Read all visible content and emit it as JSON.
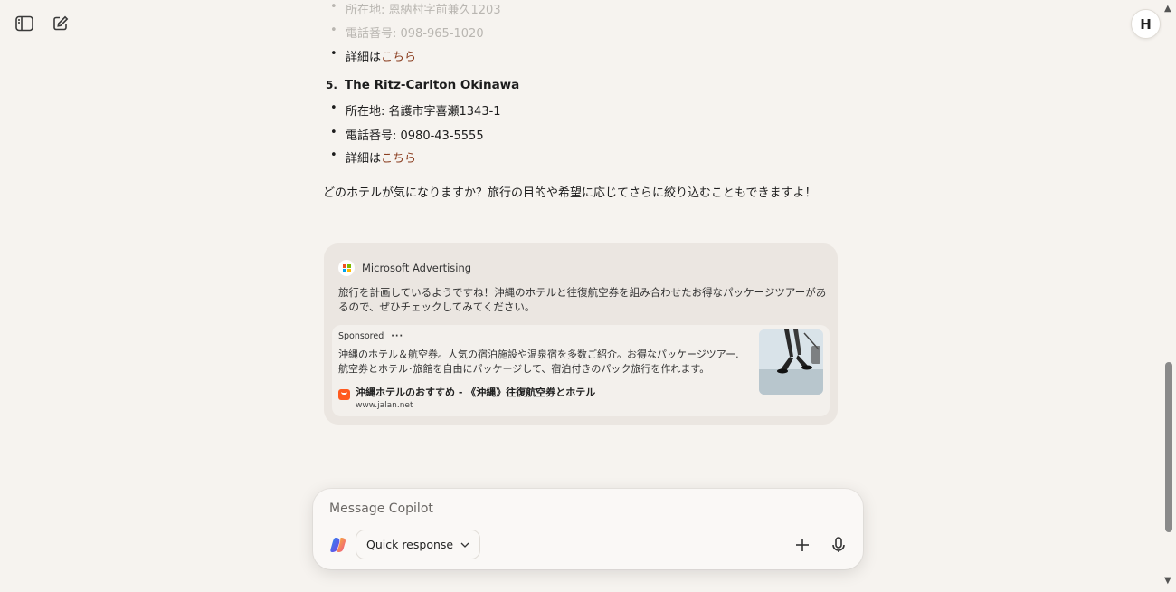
{
  "header": {
    "sidebar_icon": "sidebar-toggle-icon",
    "new_chat_icon": "new-chat-icon",
    "avatar_initial": "H"
  },
  "hotels_prev": {
    "address": "所在地: 恩納村字前兼久1203",
    "phone": "電話番号: 098-965-1020",
    "details_prefix": "詳細は",
    "details_link": "こちら"
  },
  "hotel5": {
    "number": "5.",
    "name": "The Ritz-Carlton Okinawa",
    "address": "所在地: 名護市字喜瀬1343-1",
    "phone": "電話番号: 0980-43-5555",
    "details_prefix": "詳細は",
    "details_link": "こちら"
  },
  "closing_text": "どのホテルが気になりますか？旅行の目的や希望に応じてさらに絞り込むこともできますよ！",
  "ad": {
    "source": "Microsoft Advertising",
    "intro": "旅行を計画しているようですね！沖縄のホテルと往復航空券を組み合わせたお得なパッケージツアーがあるので、ぜひチェックしてみてください。",
    "sponsored_label": "Sponsored",
    "more_label": "···",
    "description": "沖縄のホテル＆航空券。人気の宿泊施設や温泉宿を多数ご紹介。お得なパッケージツアー. 航空券とホテル･旅館を自由にパッケージして、宿泊付きのパック旅行を作れます。",
    "title": "沖縄ホテルのおすすめ - 《沖縄》往復航空券とホテル",
    "url": "www.jalan.net"
  },
  "composer": {
    "placeholder": "Message Copilot",
    "mode_label": "Quick response"
  },
  "colors": {
    "background": "#f6f3ef",
    "link": "#8a3d1f",
    "ad_card": "#ebe6e1",
    "jalan_brand": "#ff5a1f"
  }
}
